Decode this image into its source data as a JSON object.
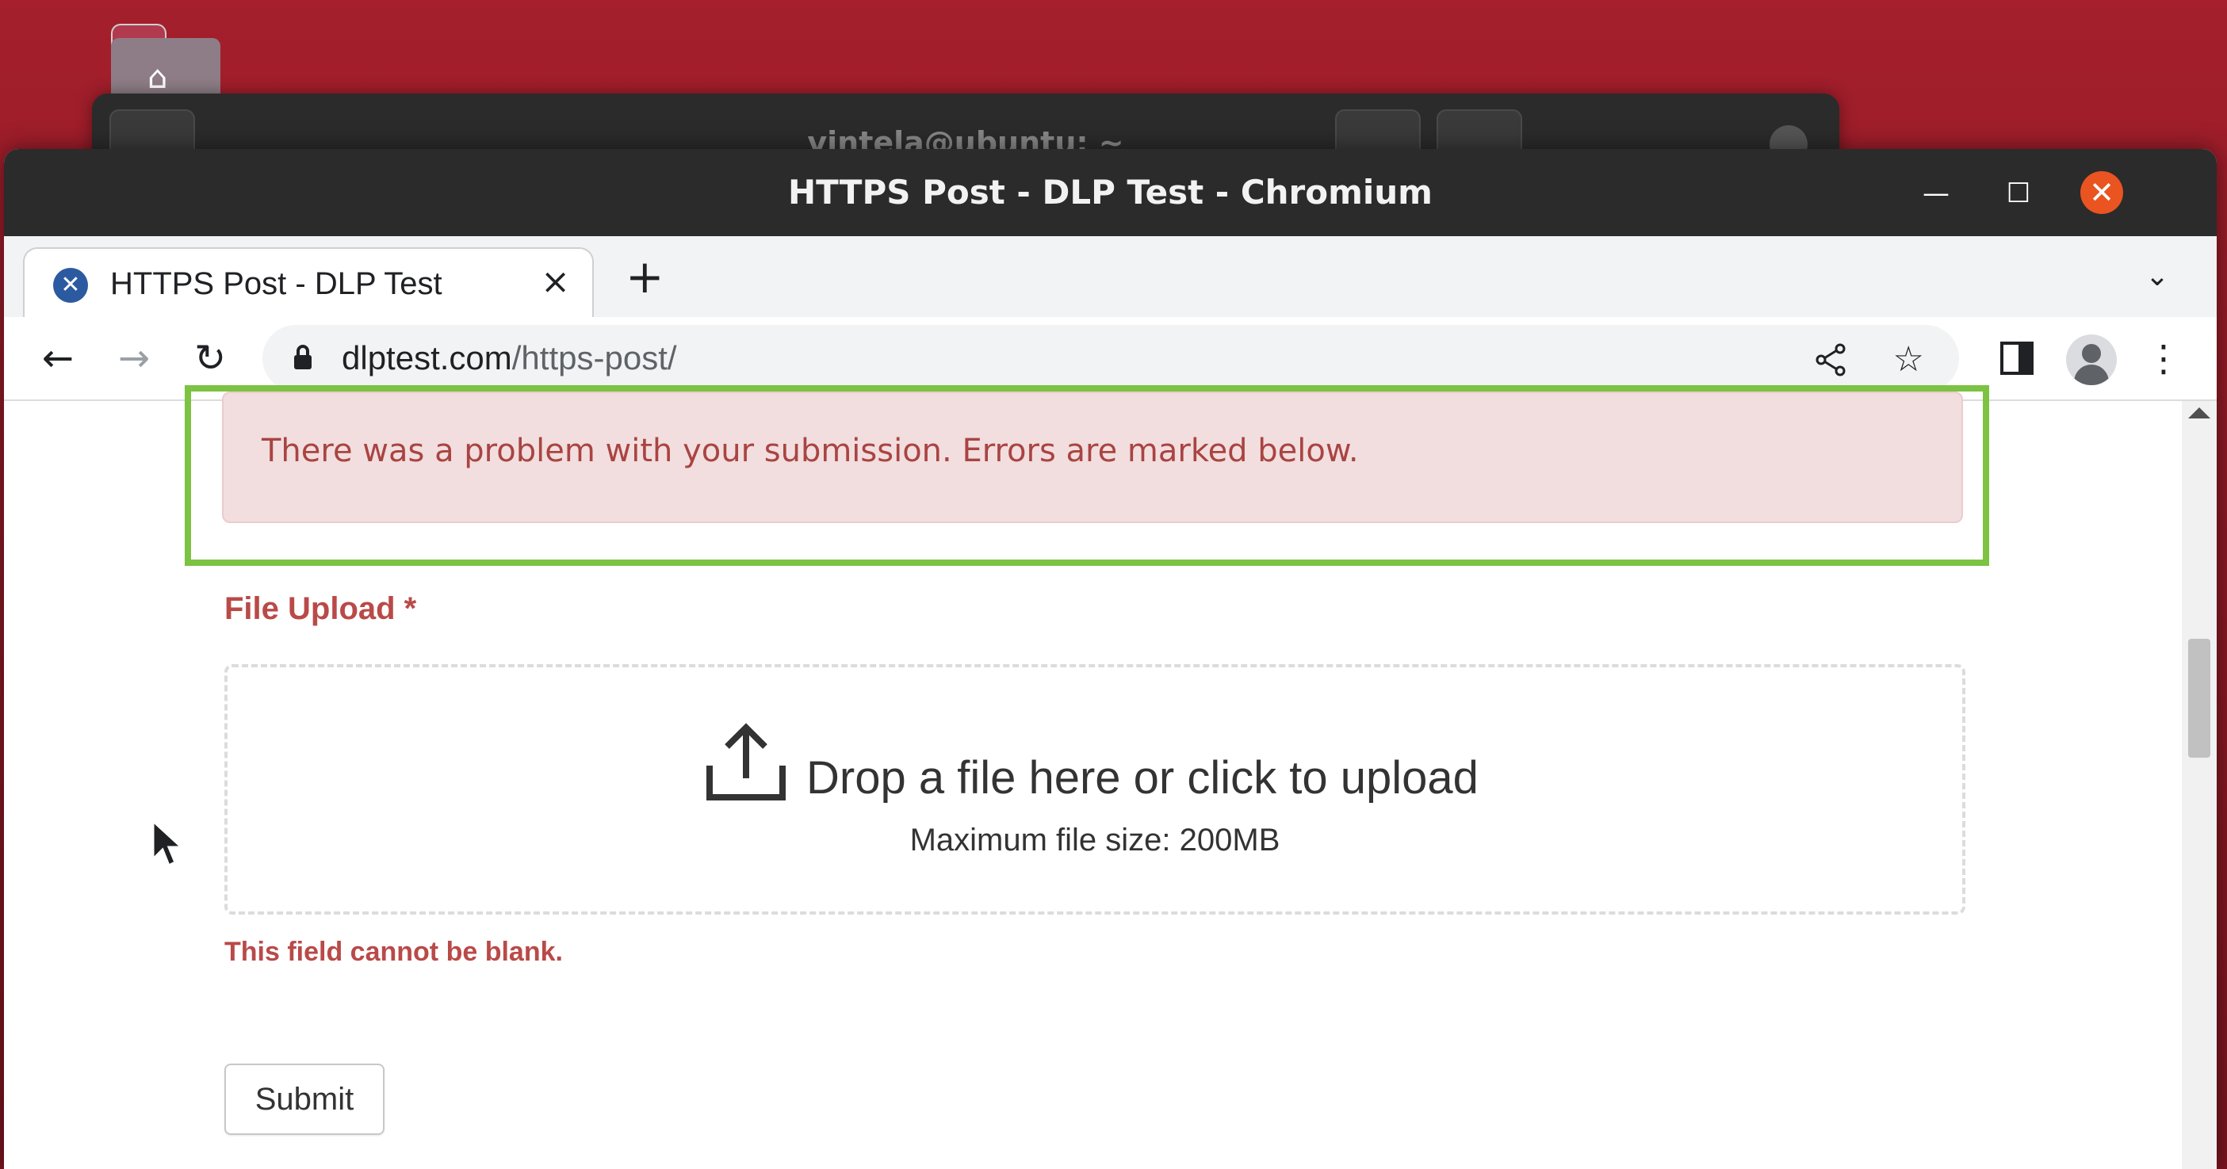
{
  "window": {
    "title": "HTTPS Post - DLP Test - Chromium",
    "minimize_icon": "minimize-icon",
    "maximize_icon": "maximize-icon",
    "close_icon": "close-icon"
  },
  "background_window": {
    "title": "vintela@ubuntu: ~"
  },
  "tabs": [
    {
      "label": "HTTPS Post - DLP Test",
      "favicon": "dlptest-favicon-icon",
      "active": true
    }
  ],
  "toolbar": {
    "url_domain": "dlptest.com",
    "url_path": "/https-post/",
    "back_icon": "back-arrow-icon",
    "forward_icon": "forward-arrow-icon",
    "reload_icon": "reload-icon"
  },
  "page": {
    "error_message": "There was a problem with your submission. Errors are marked below.",
    "field_label": "File Upload *",
    "dropzone_text": "Drop a file here or click to upload",
    "max_size": "Maximum file size: 200MB",
    "field_error": "This field cannot be blank.",
    "submit_label": "Submit"
  },
  "colors": {
    "error_text": "#a94442",
    "error_bg": "#f2dede",
    "highlight": "#7cc243",
    "ubuntu_close": "#e95420"
  }
}
